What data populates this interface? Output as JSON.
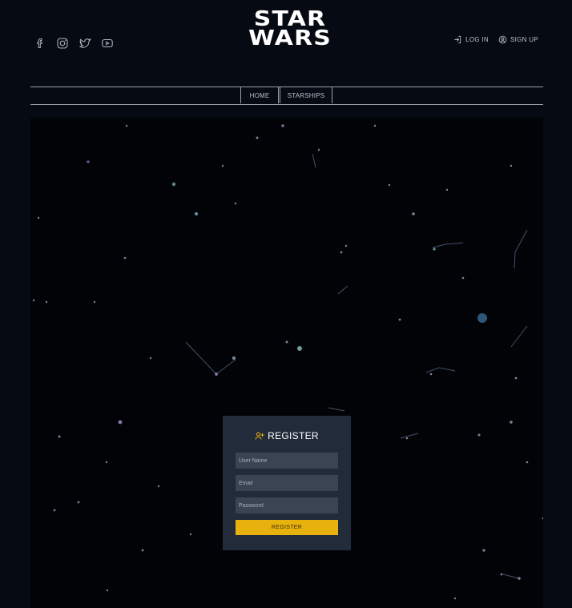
{
  "brand": {
    "logo_top": "STAR",
    "logo_bottom": "WARS"
  },
  "social": {
    "icons": [
      "facebook-icon",
      "instagram-icon",
      "twitter-icon",
      "youtube-icon"
    ]
  },
  "auth": {
    "login_label": "LOG IN",
    "signup_label": "SIGN UP"
  },
  "nav": {
    "items": [
      {
        "label": "HOME"
      },
      {
        "label": "STARSHIPS"
      }
    ]
  },
  "register": {
    "title": "REGISTER",
    "username_placeholder": "User Name",
    "email_placeholder": "Email",
    "password_placeholder": "Password",
    "submit_label": "REGISTER"
  },
  "colors": {
    "background": "#060a13",
    "hero": "#020306",
    "card": "#222b3a",
    "field": "#3b4453",
    "accent": "#e8b20e",
    "title_icon": "#e8b20e"
  }
}
